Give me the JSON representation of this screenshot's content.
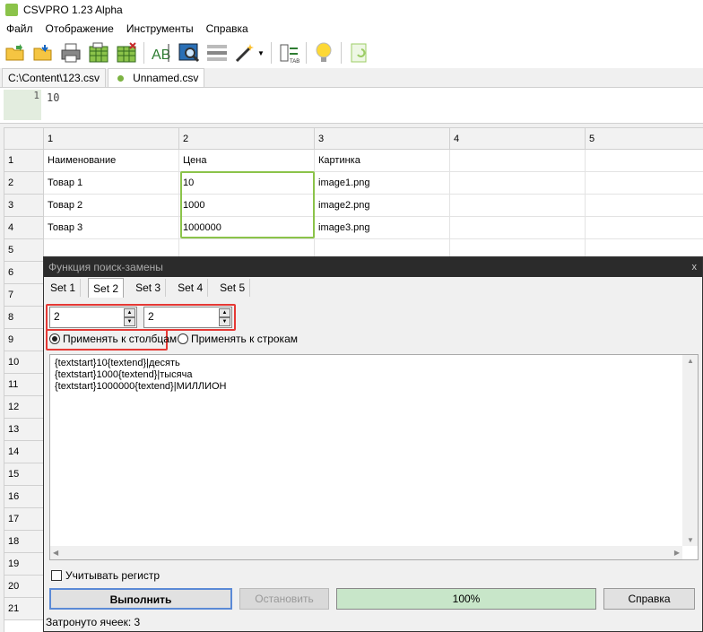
{
  "window": {
    "title": "CSVPRO 1.23 Alpha"
  },
  "menu": [
    "Файл",
    "Отображение",
    "Инструменты",
    "Справка"
  ],
  "toolbar_icons": [
    "open-folder-icon",
    "save-folder-icon",
    "printer-icon",
    "table-add-icon",
    "table-remove-icon",
    "text-ab-icon",
    "image-search-icon",
    "rows-icon",
    "magic-wand-icon",
    "column-tool-icon",
    "lightbulb-icon",
    "undo-icon"
  ],
  "tabs": [
    {
      "label": "C:\\Content\\123.csv",
      "active": false
    },
    {
      "label": "Unnamed.csv",
      "active": true
    }
  ],
  "editor": {
    "line_number": "1",
    "text": "10"
  },
  "grid": {
    "columns": [
      "1",
      "2",
      "3",
      "4",
      "5"
    ],
    "row_numbers": [
      "1",
      "2",
      "3",
      "4",
      "5",
      "6",
      "7",
      "8",
      "9",
      "10",
      "11",
      "12",
      "13",
      "14",
      "15",
      "16",
      "17",
      "18",
      "19",
      "20",
      "21"
    ],
    "rows": [
      [
        "Наименование",
        "Цена",
        "Картинка",
        "",
        ""
      ],
      [
        "Товар 1",
        "10",
        "image1.png",
        "",
        ""
      ],
      [
        "Товар 2",
        "1000",
        "image2.png",
        "",
        ""
      ],
      [
        "Товар 3",
        "1000000",
        "image3.png",
        "",
        ""
      ]
    ]
  },
  "dialog": {
    "title": "Функция поиск-замены",
    "close": "x",
    "sets": [
      "Set 1",
      "Set 2",
      "Set 3",
      "Set 4",
      "Set 5"
    ],
    "active_set": "Set 2",
    "spin1": "2",
    "spin2": "2",
    "radio_columns": "Применять к столбцам",
    "radio_rows": "Применять к строкам",
    "rules_text": "{textstart}10{textend}|десять\n{textstart}1000{textend}|тысяча\n{textstart}1000000{textend}|МИЛЛИОН",
    "case_checkbox": "Учитывать регистр",
    "execute_button": "Выполнить",
    "stop_button": "Остановить",
    "progress_text": "100%",
    "progress_value": 1.0,
    "help_button": "Справка",
    "status": "Затронуто ячеек: 3"
  },
  "colors": {
    "accent_green": "#8bc34a",
    "highlight_red": "#e53935"
  }
}
